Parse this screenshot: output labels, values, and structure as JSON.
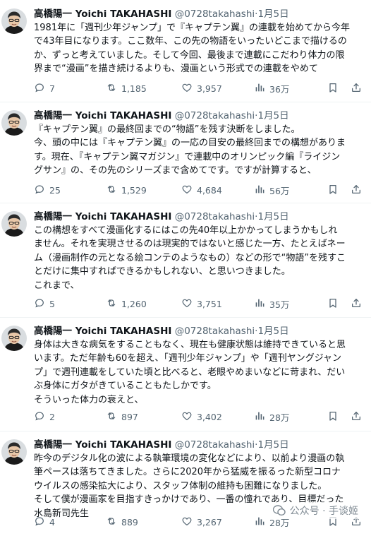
{
  "author": {
    "name": "高橋陽一 Yoichi TAKAHASHI",
    "handle": "@0728takahashi",
    "separator": "·"
  },
  "tweets": [
    {
      "date": "1月5日",
      "lines": [
        "1981年に「週刊少年ジャンプ」で『キャプテン翼』の連載を始めてから今年",
        "で43年目になります。ここ数年、この先の物語をいったいどこまで描けるの",
        "か、ずっと考えていました。そして今回、最後まで連載にこだわり体力の限",
        "界まで“漫画”を描き続けるよりも、漫画という形式での連載をやめて"
      ],
      "stats": {
        "replies": "7",
        "retweets": "1,185",
        "likes": "3,957",
        "views": "36万"
      }
    },
    {
      "date": "1月5日",
      "lines": [
        "『キャプテン翼』の最終回までの“物語”を残す決断をしました。",
        "今、頭の中には『キャプテン翼』の一応の目安の最終回までの構想がありま",
        "す。現在、『キャプテン翼マガジン』で連載中のオリンピック編『ライジン",
        "グサン』の、その先のシリーズまで含めてです。ですが計算すると、"
      ],
      "stats": {
        "replies": "25",
        "retweets": "1,529",
        "likes": "4,684",
        "views": "56万"
      }
    },
    {
      "date": "1月5日",
      "lines": [
        "この構想をすべて漫画化するにはこの先40年以上かかってしまうかもしれ",
        "ません。それを実現させるのは現実的ではないと感じた一方、たとえばネー",
        "ム（漫画制作の元となる絵コンテのようなもの）などの形で“物語”を残すこ",
        "とだけに集中すればできるかもしれない、と思いつきました。",
        "これまで、"
      ],
      "stats": {
        "replies": "5",
        "retweets": "1,260",
        "likes": "3,751",
        "views": "35万"
      }
    },
    {
      "date": "1月5日",
      "lines": [
        "身体は大きな病気をすることもなく、現在も健康状態は維持できていると思",
        "います。ただ年齢も60を超え、「週刊少年ジャンプ」や「週刊ヤングジャン",
        "プ」で週刊連載をしていた頃と比べると、老眼やめまいなどに苛まれ、だい",
        "ぶ身体にガタがきていることもたしかです。",
        "そういった体力の衰えと、"
      ],
      "stats": {
        "replies": "2",
        "retweets": "897",
        "likes": "3,402",
        "views": "28万"
      }
    },
    {
      "date": "1月5日",
      "lines": [
        "昨今のデジタル化の波による執筆環境の変化などにより、以前より漫画の執",
        "筆ペースは落ちてきました。さらに2020年から猛威を振るった新型コロナ",
        "ウイルスの感染拡大により、スタッフ体制の維持も困難になりました。",
        "そして僕が漫画家を目指すきっかけであり、一番の憧れであり、目標だった",
        "水島新司先生"
      ],
      "stats": {
        "replies": "4",
        "retweets": "889",
        "likes": "3,267",
        "views": "28万"
      }
    }
  ],
  "watermark": {
    "text": "公众号 · 手谈姬"
  },
  "colors": {
    "text": "#0f1419",
    "secondary": "#536471",
    "divider": "#eff3f4"
  },
  "icons": [
    "reply-icon",
    "retweet-icon",
    "like-icon",
    "views-icon",
    "bookmark-icon",
    "share-icon"
  ]
}
